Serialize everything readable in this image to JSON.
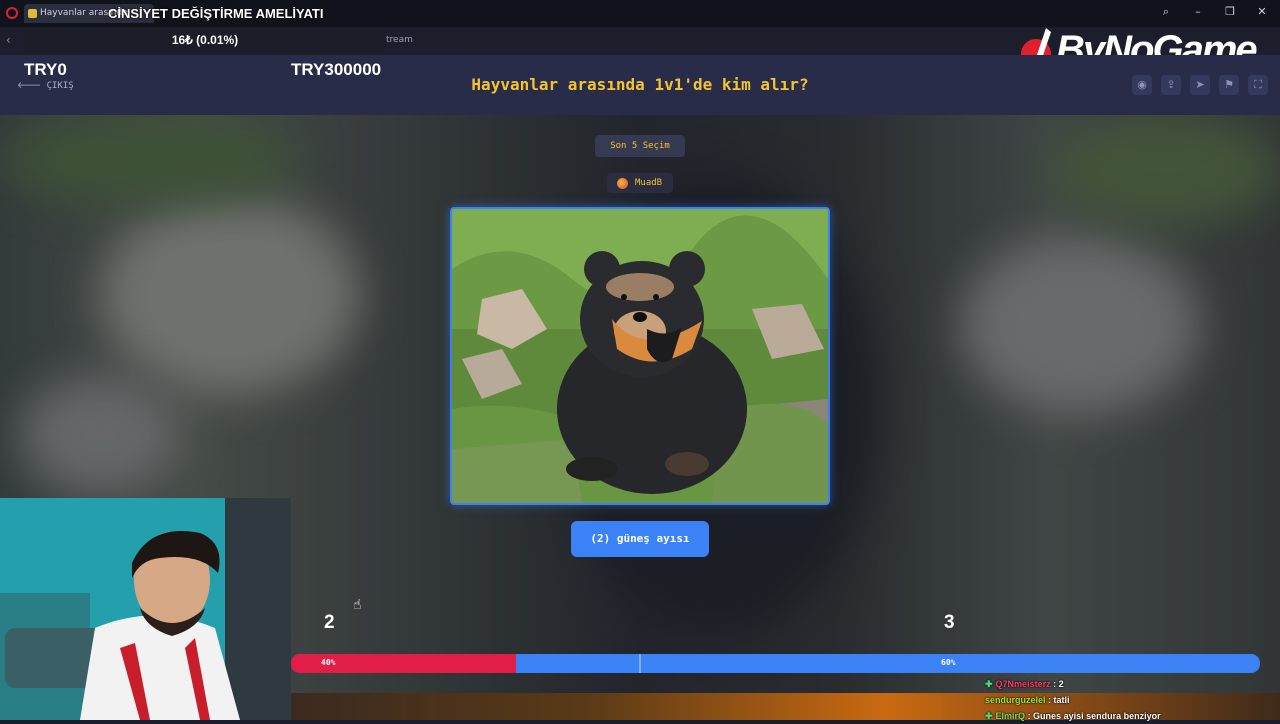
{
  "browser": {
    "tab_title": "Hayvanlar arasında",
    "url_fragment": "tream"
  },
  "overlay": {
    "stream_title": "CİNSİYET DEĞİŞTİRME AMELİYATI",
    "donation": "16₺ (0.01%)",
    "brand": "ByNoGame"
  },
  "header": {
    "try_left": "TRY0",
    "try_right": "TRY300000",
    "exit_label": "ÇIKIŞ",
    "question": "Hayvanlar arasında 1v1'de kim alır?"
  },
  "game": {
    "last_picks_label": "Son 5 Seçim",
    "voter_name": "MuadB",
    "choice_label": "(2) güneş ayısı",
    "score_left": "2",
    "score_right": "3",
    "pct_left_label": "40%",
    "pct_right_label": "60%",
    "pct_left_value": 40
  },
  "chat": [
    {
      "user": "Q7Nmeisterz",
      "msg": " : 2"
    },
    {
      "user": "sendurguzelel",
      "msg": " : tatli"
    },
    {
      "user": "ElmirQ",
      "msg": " : Gunes ayisi sendura benziyor"
    }
  ],
  "colors": {
    "accent_blue": "#3b82f6",
    "accent_red": "#e11d48",
    "question_yellow": "#f4c430"
  }
}
